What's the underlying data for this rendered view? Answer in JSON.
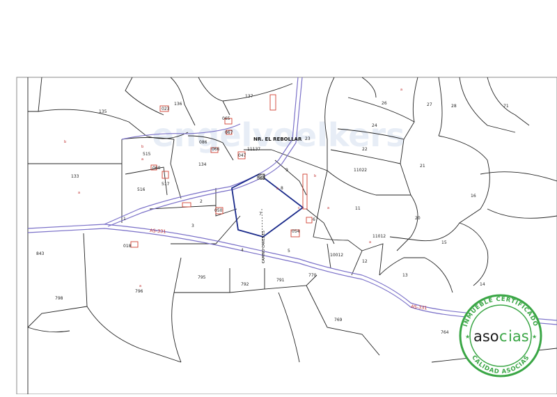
{
  "map": {
    "place_label": "NR. EL REBOLLAR",
    "place_number": "23",
    "road_labels": [
      "AS-331",
      "AS-331"
    ],
    "path_label": "CAMINO CARES-ES",
    "watermark": "engelvoelkers",
    "parcels": [
      "137",
      "136",
      "135",
      "023",
      "065",
      "067",
      "11137",
      "23",
      "066",
      "086",
      "515",
      "134",
      "047",
      "068",
      "517",
      "133",
      "516",
      "060",
      "2",
      "050",
      "7",
      "9",
      "1",
      "3",
      "4",
      "5",
      "11022",
      "21",
      "22",
      "24",
      "26",
      "27",
      "28",
      "71",
      "16",
      "11",
      "20",
      "15",
      "14",
      "13",
      "12",
      "11012",
      "10012",
      "8",
      "6",
      "054",
      "058",
      "018",
      "843",
      "798",
      "795",
      "792",
      "791",
      "770",
      "796",
      "769",
      "764"
    ],
    "parcel_letters": [
      "b",
      "a",
      "b",
      "a",
      "a",
      "b",
      "a",
      "c",
      "a",
      "a",
      "a"
    ]
  },
  "seal": {
    "brand_left": "aso",
    "brand_mid": "c",
    "brand_right": "ias",
    "top_text": "INMUEBLE CERTIFICADO",
    "bottom_text": "CALIDAD ASOCIAS",
    "colors": {
      "ring": "#3aa645",
      "text_dark": "#1a1a1a",
      "accent": "#3aa645"
    }
  },
  "colors": {
    "parcel_lines": "#222222",
    "roads": "#7a70c8",
    "buildings": "#d04030",
    "selected_parcel": "#1a2a8a"
  }
}
